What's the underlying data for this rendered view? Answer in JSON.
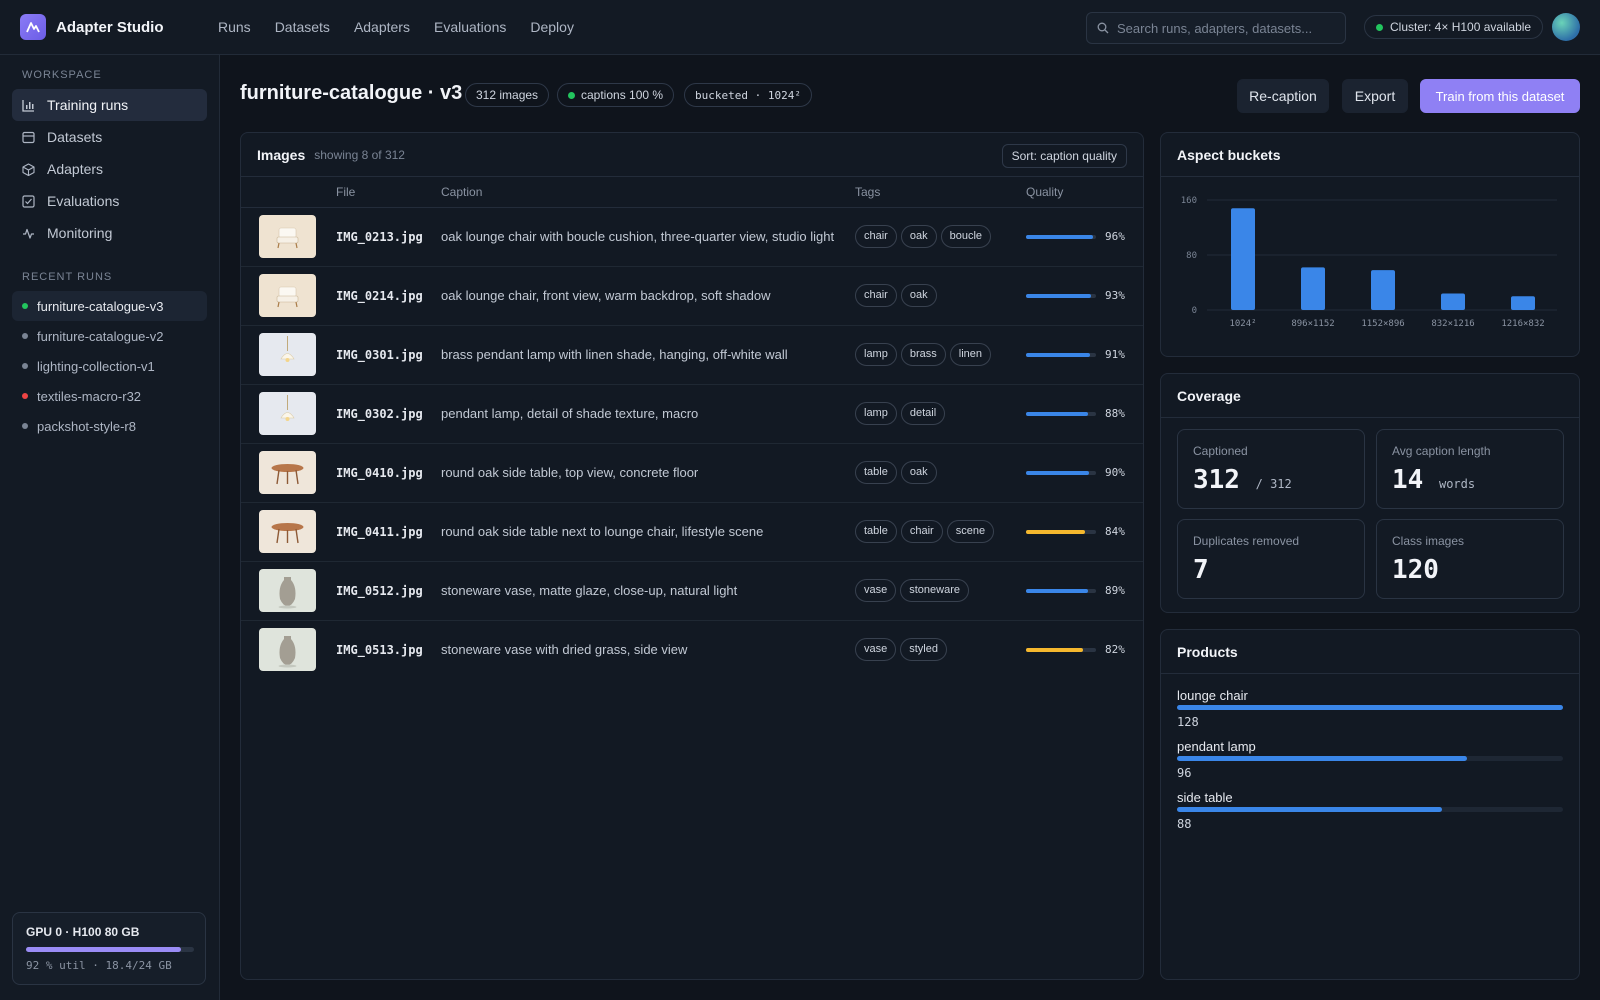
{
  "app": {
    "name": "Adapter Studio"
  },
  "nav": [
    "Runs",
    "Datasets",
    "Adapters",
    "Evaluations",
    "Deploy"
  ],
  "search": {
    "placeholder": "Search runs, adapters, datasets..."
  },
  "cluster": {
    "label": "Cluster: 4× H100 available",
    "status_color": "#22c55e"
  },
  "sidebar": {
    "workspace_heading": "WORKSPACE",
    "items": [
      {
        "label": "Training runs",
        "icon": "bar-chart-icon"
      },
      {
        "label": "Datasets",
        "icon": "database-icon"
      },
      {
        "label": "Adapters",
        "icon": "cube-icon"
      },
      {
        "label": "Evaluations",
        "icon": "checklist-icon"
      },
      {
        "label": "Monitoring",
        "icon": "pulse-icon"
      }
    ],
    "recent_heading": "RECENT RUNS",
    "runs": [
      {
        "label": "furniture-catalogue-v3",
        "color": "#22c55e"
      },
      {
        "label": "furniture-catalogue-v2",
        "color": "#7a8494"
      },
      {
        "label": "lighting-collection-v1",
        "color": "#7a8494"
      },
      {
        "label": "textiles-macro-r32",
        "color": "#ef4444"
      },
      {
        "label": "packshot-style-r8",
        "color": "#7a8494"
      }
    ],
    "gpu": {
      "title": "GPU 0 · H100 80 GB",
      "stat": "92 % util · 18.4/24 GB",
      "util": 0.92
    }
  },
  "header": {
    "title": "furniture-catalogue · v3",
    "pill_images": "312 images",
    "pill_captions": "captions 100 %",
    "pill_bucketed": "bucketed · 1024²",
    "btn_recaption": "Re-caption",
    "btn_export": "Export",
    "btn_train": "Train from this dataset"
  },
  "images": {
    "title": "Images",
    "subtitle": "showing 8 of 312",
    "sort": "Sort: caption quality",
    "columns": [
      "File",
      "Caption",
      "Tags",
      "Quality"
    ],
    "rows": [
      {
        "thumb": "chair",
        "file": "IMG_0213.jpg",
        "caption": "oak lounge chair with boucle cushion, three-quarter view, studio light",
        "tags": [
          "chair",
          "oak",
          "boucle"
        ],
        "quality": 96,
        "quality_label": "96%"
      },
      {
        "thumb": "chair",
        "file": "IMG_0214.jpg",
        "caption": "oak lounge chair, front view, warm backdrop, soft shadow",
        "tags": [
          "chair",
          "oak"
        ],
        "quality": 93,
        "quality_label": "93%"
      },
      {
        "thumb": "lamp",
        "file": "IMG_0301.jpg",
        "caption": "brass pendant lamp with linen shade, hanging, off-white wall",
        "tags": [
          "lamp",
          "brass",
          "linen"
        ],
        "quality": 91,
        "quality_label": "91%"
      },
      {
        "thumb": "lamp",
        "file": "IMG_0302.jpg",
        "caption": "pendant lamp, detail of shade texture, macro",
        "tags": [
          "lamp",
          "detail"
        ],
        "quality": 88,
        "quality_label": "88%"
      },
      {
        "thumb": "table",
        "file": "IMG_0410.jpg",
        "caption": "round oak side table, top view, concrete floor",
        "tags": [
          "table",
          "oak"
        ],
        "quality": 90,
        "quality_label": "90%"
      },
      {
        "thumb": "table",
        "file": "IMG_0411.jpg",
        "caption": "round oak side table next to lounge chair, lifestyle scene",
        "tags": [
          "table",
          "chair",
          "scene"
        ],
        "quality": 84,
        "quality_label": "84%"
      },
      {
        "thumb": "vase",
        "file": "IMG_0512.jpg",
        "caption": "stoneware vase, matte glaze, close-up, natural light",
        "tags": [
          "vase",
          "stoneware"
        ],
        "quality": 89,
        "quality_label": "89%"
      },
      {
        "thumb": "vase",
        "file": "IMG_0513.jpg",
        "caption": "stoneware vase with dried grass, side view",
        "tags": [
          "vase",
          "styled"
        ],
        "quality": 82,
        "quality_label": "82%"
      }
    ],
    "color_good": "#3a86e8",
    "color_warn": "#f5b82e"
  },
  "aspect": {
    "title": "Aspect buckets",
    "chart_data": {
      "type": "bar",
      "categories": [
        "1024²",
        "896×1152",
        "1152×896",
        "832×1216",
        "1216×832"
      ],
      "values": [
        148,
        62,
        58,
        24,
        20
      ],
      "ylim": [
        0,
        160
      ],
      "yticks": [
        "0",
        "80",
        "160"
      ],
      "color": "#3a86e8"
    }
  },
  "coverage": {
    "title": "Coverage",
    "captioned_label": "Captioned",
    "captioned_value": "312",
    "captioned_total": "/ 312",
    "avg_label": "Avg caption length",
    "avg_value": "14",
    "avg_unit": "words",
    "dup_label": "Duplicates removed",
    "dup_value": "7",
    "class_label": "Class images",
    "class_value": "120"
  },
  "products": {
    "title": "Products",
    "max": 128,
    "items": [
      {
        "name": "lounge chair",
        "count": 128,
        "count_label": "128"
      },
      {
        "name": "pendant lamp",
        "count": 96,
        "count_label": "96"
      },
      {
        "name": "side table",
        "count": 88,
        "count_label": "88"
      }
    ]
  }
}
